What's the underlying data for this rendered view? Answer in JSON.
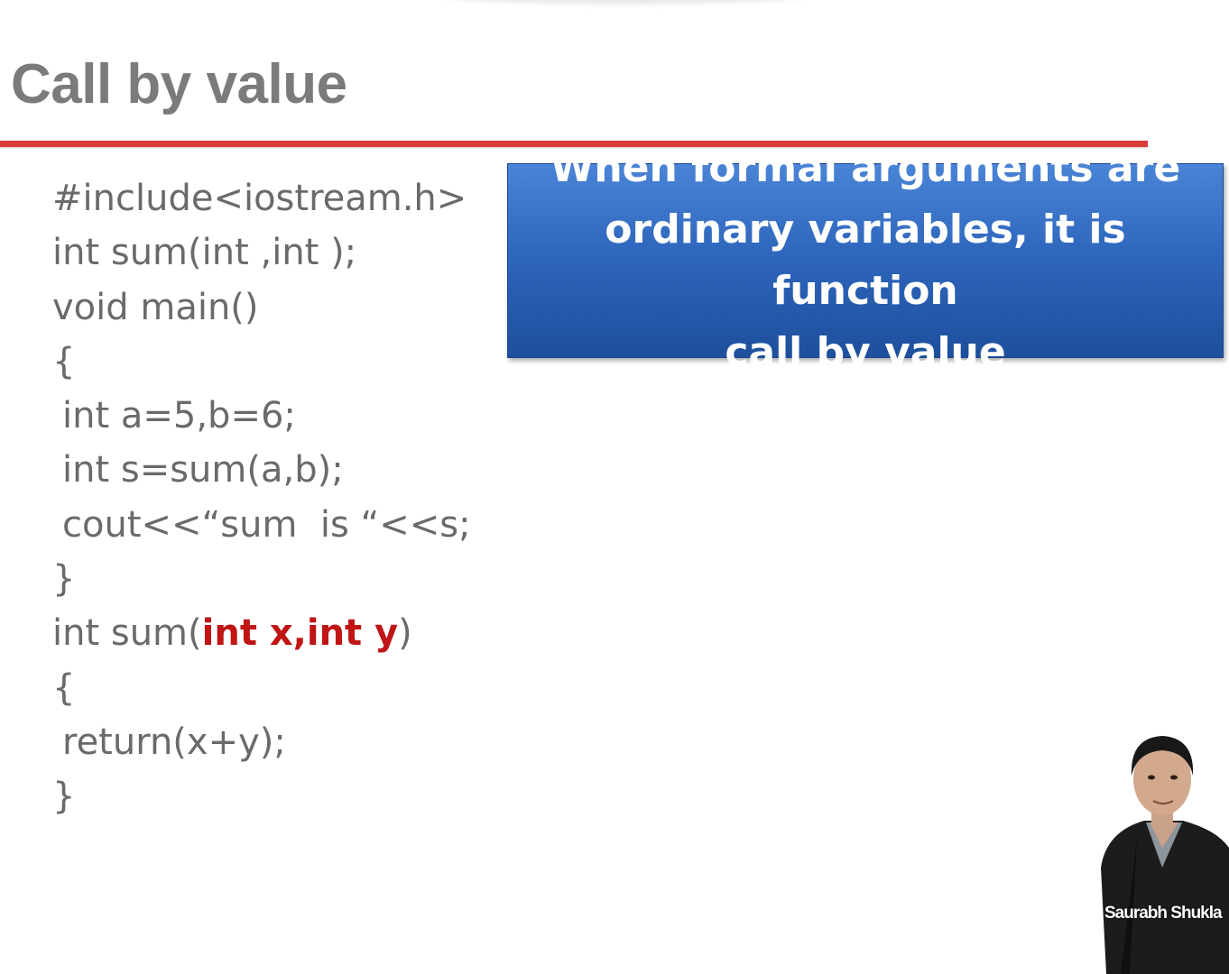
{
  "slide": {
    "title": "Call by value",
    "accent_color": "#d93a3a",
    "callout_color": "#2f67bd",
    "code_highlight_color": "#c01515"
  },
  "code_lines": [
    {
      "text": "#include<iostream.h>"
    },
    {
      "text": "int sum(int ,int );"
    },
    {
      "text": "void main()"
    },
    {
      "text": "{"
    },
    {
      "text": "int a=5,b=6;"
    },
    {
      "text": "int s=sum(a,b);"
    },
    {
      "text": "cout<<“sum  is “<<s;"
    },
    {
      "text": "}"
    },
    {
      "pre": "int sum(",
      "highlight": "int x,int y",
      "post": ")"
    },
    {
      "text": "{"
    },
    {
      "text": "return(x+y);"
    },
    {
      "text": "}"
    }
  ],
  "callout": {
    "lines": [
      "When formal arguments are",
      "ordinary variables, it is function",
      "call by value"
    ]
  },
  "presenter": {
    "name": "Saurabh Shukla"
  }
}
